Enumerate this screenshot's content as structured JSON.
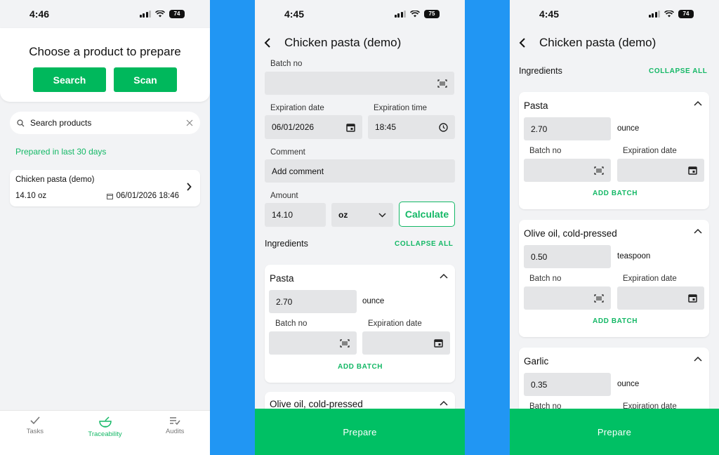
{
  "colors": {
    "brand_green": "#00b85c",
    "background_blue": "#2196f3"
  },
  "screen1": {
    "status": {
      "time": "4:46",
      "battery": "74"
    },
    "title": "Choose a product to prepare",
    "search_button": "Search",
    "scan_button": "Scan",
    "search_placeholder": "Search products",
    "recent_label": "Prepared in last 30 days",
    "product": {
      "name": "Chicken pasta (demo)",
      "amount": "14.10 oz",
      "datetime": "06/01/2026 18:46"
    },
    "tabs": [
      {
        "label": "Tasks",
        "icon": "check-icon"
      },
      {
        "label": "Traceability",
        "icon": "bowl-icon"
      },
      {
        "label": "Audits",
        "icon": "list-check-icon"
      }
    ]
  },
  "screen2": {
    "status": {
      "time": "4:45",
      "battery": "75"
    },
    "title": "Chicken pasta (demo)",
    "batch_label": "Batch no",
    "exp_date_label": "Expiration date",
    "exp_date_value": "06/01/2026",
    "exp_time_label": "Expiration time",
    "exp_time_value": "18:45",
    "comment_label": "Comment",
    "comment_placeholder": "Add comment",
    "amount_label": "Amount",
    "amount_value": "14.10",
    "unit_value": "oz",
    "calculate_button": "Calculate",
    "ingredients_label": "Ingredients",
    "collapse_all": "COLLAPSE ALL",
    "ingredient": {
      "name": "Pasta",
      "qty": "2.70",
      "unit": "ounce",
      "batch_label": "Batch no",
      "exp_label": "Expiration date",
      "add_batch": "ADD BATCH"
    },
    "next_ingredient": "Olive oil, cold-pressed",
    "prepare_button": "Prepare"
  },
  "screen3": {
    "status": {
      "time": "4:45",
      "battery": "74"
    },
    "title": "Chicken pasta (demo)",
    "ingredients_label": "Ingredients",
    "collapse_all": "COLLAPSE ALL",
    "ingredients": [
      {
        "name": "Pasta",
        "qty": "2.70",
        "unit": "ounce",
        "batch_label": "Batch no",
        "exp_label": "Expiration date",
        "add_batch": "ADD BATCH"
      },
      {
        "name": "Olive oil, cold-pressed",
        "qty": "0.50",
        "unit": "teaspoon",
        "batch_label": "Batch no",
        "exp_label": "Expiration date",
        "add_batch": "ADD BATCH"
      },
      {
        "name": "Garlic",
        "qty": "0.35",
        "unit": "ounce",
        "batch_label": "Batch no",
        "exp_label": "Expiration date"
      }
    ],
    "prepare_button": "Prepare"
  }
}
